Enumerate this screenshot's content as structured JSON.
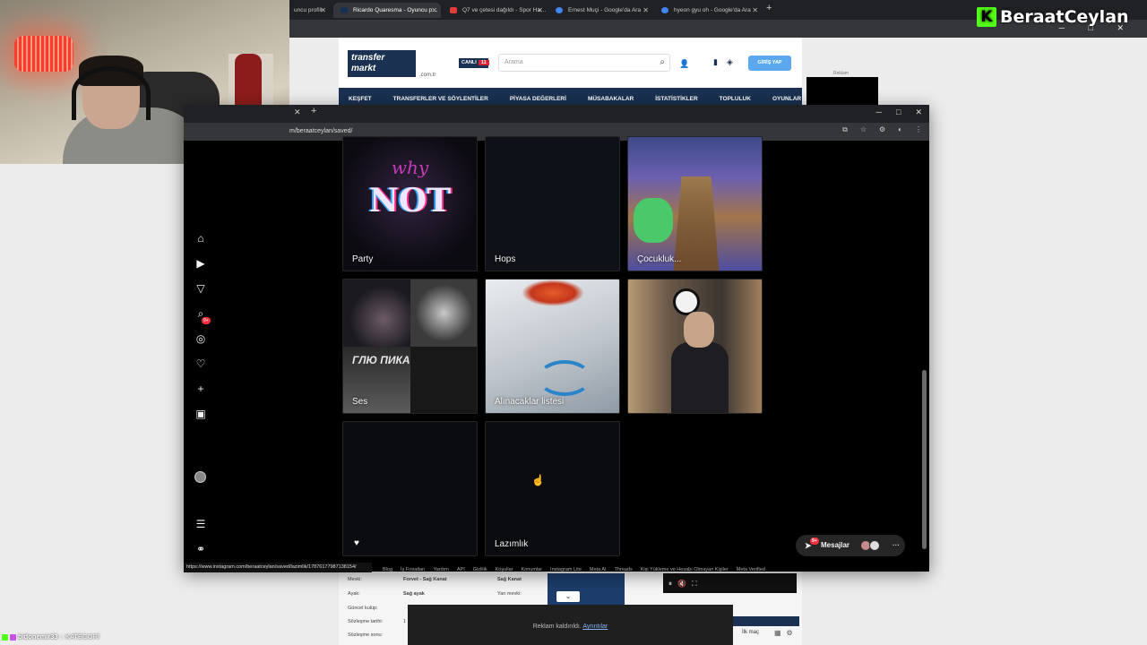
{
  "streamer": {
    "name": "BeraatCeylan",
    "overlay_letter": "K"
  },
  "background_browser": {
    "tabs": [
      {
        "title": "uncu profili",
        "color": "#444"
      },
      {
        "title": "Ricardo Quaresma - Oyuncu p…",
        "color": "#1a3151"
      },
      {
        "title": "Q7 ve çetesi dağıldı - Spor Ha…",
        "color": "#e03a3a"
      },
      {
        "title": "Ernest Muçi - Google'da Ara",
        "color": "#4285f4"
      },
      {
        "title": "hyeon gyu oh - Google'da Ara",
        "color": "#4285f4"
      }
    ],
    "window_controls": "─ □ ✕"
  },
  "transfermarkt": {
    "logo_line1": "transfer",
    "logo_line2": "markt",
    "logo_suffix": ".com.tr",
    "live_label": "CANLI",
    "live_count": "11",
    "search_placeholder": "Arama",
    "login": "GİRİŞ YAP",
    "nav": [
      "KEŞFET",
      "TRANSFERLER VE SÖYLENTİLER",
      "PİYASA DEĞERLERİ",
      "MÜSABAKALAR",
      "İSTATİSTİKLER",
      "TOPLULUK",
      "OYUNLAR"
    ],
    "ad_label": "Reklam",
    "details": [
      {
        "label": "Mevki:",
        "value": "Forvet - Sağ Kanat"
      },
      {
        "label": "Ayak:",
        "value": "Sağ ayak"
      },
      {
        "label": "Güncel kulüp:",
        "value": ""
      },
      {
        "label": "Sözleşme tarihi:",
        "value": "1"
      },
      {
        "label": "Sözleşme sonu:",
        "value": ""
      }
    ],
    "side_positions": [
      "Sağ Kanat",
      "Yan mevki:"
    ],
    "ad_removed": "Reklam kaldırıldı.",
    "ad_details_link": "Ayrıntılar",
    "ilk_mac": "İlk maç"
  },
  "instagram": {
    "url": "m/beraatceylan/saved/",
    "collections": [
      {
        "name": "Party"
      },
      {
        "name": "Hops"
      },
      {
        "name": "Çocukluk..."
      },
      {
        "name": "Ses"
      },
      {
        "name": "Alınacaklar listesi"
      },
      {
        "name": ""
      },
      {
        "name": ""
      },
      {
        "name": "Lazımlık"
      }
    ],
    "party_art_top": "why",
    "party_art_main": "NOT",
    "ses_art_text": "ГЛЮ ПИКА",
    "notification_badge": "9+",
    "messages_label": "Mesajlar",
    "messages_badge": "9+",
    "status_url": "https://www.instagram.com/beraatceylan/saved/lazimlik/17876177987138154/",
    "footer_links": [
      "Blog",
      "İş Fırsatları",
      "Yardım",
      "API",
      "Gizlilik",
      "Koşullar",
      "Konumlar",
      "Instagram Lite",
      "Meta AI",
      "Threads",
      "Kişi Yükleme ve Hesabı Olmayan Kişiler",
      "Meta Verified"
    ],
    "sidebar_icons": [
      "home-icon",
      "reels-icon",
      "messages-icon",
      "search-icon",
      "explore-icon",
      "notifications-icon",
      "create-icon",
      "dashboard-icon",
      "profile-avatar",
      "menu-icon",
      "threads-icon"
    ]
  },
  "kick_bar": {
    "user": "bidonemir33",
    "category": "KATEGORİ"
  }
}
